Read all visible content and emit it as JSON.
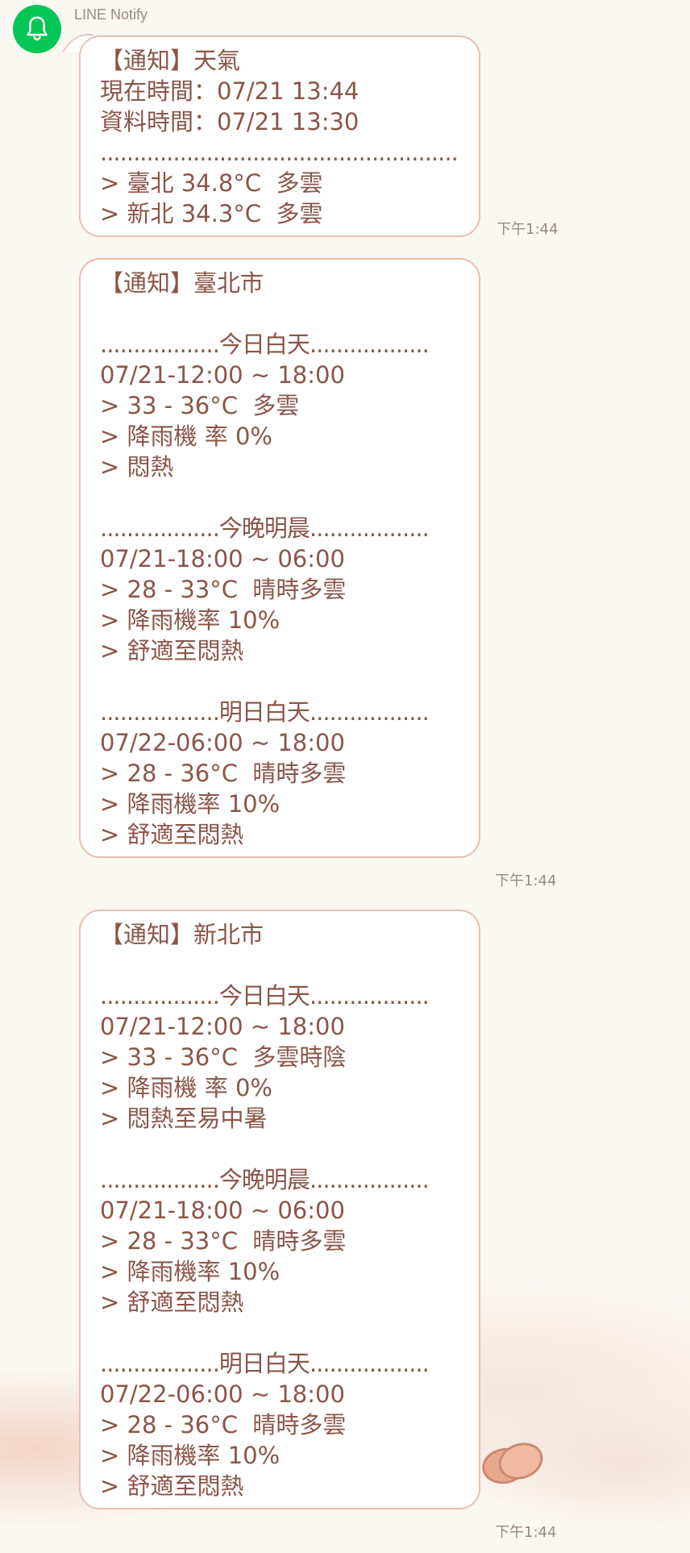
{
  "sender": {
    "name": "LINE Notify",
    "avatar_icon": "bell-icon",
    "avatar_color": "#06c755"
  },
  "messages": [
    {
      "time": "下午1:44",
      "lines": [
        "【通知】天氣",
        "現在時間：07/21 13:44",
        "資料時間：07/21 13:30",
        "........................................................",
        "> 臺北 34.8°C  多雲",
        "> 新北 34.3°C  多雲"
      ]
    },
    {
      "time": "下午1:44",
      "lines": [
        "【通知】臺北市",
        "",
        "..................今日白天..................",
        "07/21-12:00 ~ 18:00",
        "> 33 - 36°C  多雲",
        "> 降雨機 率 0%",
        "> 悶熱",
        "",
        "..................今晚明晨..................",
        "07/21-18:00 ~ 06:00",
        "> 28 - 33°C  晴時多雲",
        "> 降雨機率 10%",
        "> 舒適至悶熱",
        "",
        "..................明日白天..................",
        "07/22-06:00 ~ 18:00",
        "> 28 - 36°C  晴時多雲",
        "> 降雨機率 10%",
        "> 舒適至悶熱"
      ]
    },
    {
      "time": "下午1:44",
      "lines": [
        "【通知】新北市",
        "",
        "..................今日白天..................",
        "07/21-12:00 ~ 18:00",
        "> 33 - 36°C  多雲時陰",
        "> 降雨機 率 0%",
        "> 悶熱至易中暑",
        "",
        "..................今晚明晨..................",
        "07/21-18:00 ~ 06:00",
        "> 28 - 33°C  晴時多雲",
        "> 降雨機率 10%",
        "> 舒適至悶熱",
        "",
        "..................明日白天..................",
        "07/22-06:00 ~ 18:00",
        "> 28 - 36°C  晴時多雲",
        "> 降雨機率 10%",
        "> 舒適至悶熱"
      ]
    }
  ]
}
